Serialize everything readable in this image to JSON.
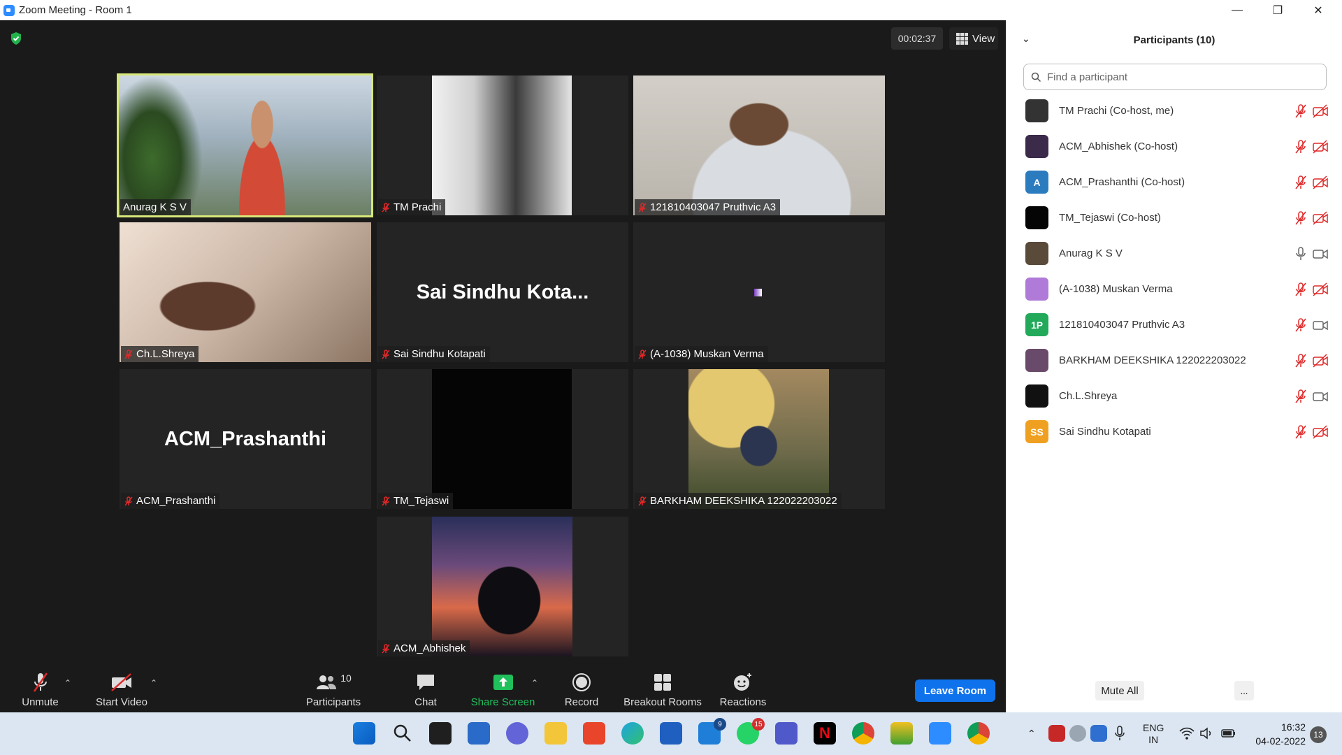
{
  "window": {
    "title": "Zoom Meeting - Room 1"
  },
  "meeting": {
    "timer": "00:02:37",
    "view_label": "View",
    "tiles": [
      {
        "name": "Anurag K S V",
        "muted": false,
        "active": true,
        "show_name_only": false
      },
      {
        "name": "TM Prachi",
        "muted": true,
        "show_name_only": false
      },
      {
        "name": "121810403047 Pruthvic A3",
        "muted": true,
        "show_name_only": false
      },
      {
        "name": "Ch.L.Shreya",
        "muted": true,
        "show_name_only": false
      },
      {
        "name": "Sai Sindhu Kotapati",
        "display": "Sai Sindhu Kota...",
        "muted": true,
        "show_name_only": true
      },
      {
        "name": "(A-1038) Muskan Verma",
        "muted": true,
        "show_name_only": false
      },
      {
        "name": "ACM_Prashanthi",
        "display": "ACM_Prashanthi",
        "muted": true,
        "show_name_only": true
      },
      {
        "name": "TM_Tejaswi",
        "muted": true,
        "show_name_only": false
      },
      {
        "name": "BARKHAM DEEKSHIKA 122022203022",
        "muted": true,
        "show_name_only": false
      },
      {
        "name": "ACM_Abhishek",
        "muted": true,
        "show_name_only": false
      }
    ]
  },
  "toolbar": {
    "unmute": "Unmute",
    "start_video": "Start Video",
    "participants": "Participants",
    "participants_count": "10",
    "chat": "Chat",
    "share_screen": "Share Screen",
    "record": "Record",
    "breakout_rooms": "Breakout Rooms",
    "reactions": "Reactions",
    "leave_room": "Leave Room"
  },
  "panel": {
    "title": "Participants (10)",
    "search_placeholder": "Find a participant",
    "participants": [
      {
        "name": "TM Prachi (Co-host, me)",
        "avatar_color": "#333333",
        "initials": "",
        "mic": "muted",
        "cam": "off"
      },
      {
        "name": "ACM_Abhishek (Co-host)",
        "avatar_color": "#3b2a4a",
        "initials": "",
        "mic": "muted",
        "cam": "off"
      },
      {
        "name": "ACM_Prashanthi (Co-host)",
        "avatar_color": "#2b7bbf",
        "initials": "A",
        "mic": "muted",
        "cam": "off"
      },
      {
        "name": "TM_Tejaswi (Co-host)",
        "avatar_color": "#050505",
        "initials": "",
        "mic": "muted",
        "cam": "off"
      },
      {
        "name": "Anurag K S V",
        "avatar_color": "#5a4a3a",
        "initials": "",
        "mic": "on",
        "cam": "on"
      },
      {
        "name": "(A-1038) Muskan Verma",
        "avatar_color": "#b07ad8",
        "initials": "",
        "mic": "muted",
        "cam": "off"
      },
      {
        "name": "121810403047 Pruthvic A3",
        "avatar_color": "#22a95a",
        "initials": "1P",
        "mic": "muted",
        "cam": "on"
      },
      {
        "name": "BARKHAM DEEKSHIKA 122022203022",
        "avatar_color": "#6a4a6a",
        "initials": "",
        "mic": "muted",
        "cam": "off"
      },
      {
        "name": "Ch.L.Shreya",
        "avatar_color": "#111111",
        "initials": "",
        "mic": "muted",
        "cam": "on"
      },
      {
        "name": "Sai Sindhu Kotapati",
        "avatar_color": "#f0a020",
        "initials": "SS",
        "mic": "muted",
        "cam": "off"
      }
    ],
    "mute_all": "Mute All",
    "more": "..."
  },
  "taskbar": {
    "lang_top": "ENG",
    "lang_bottom": "IN",
    "time": "16:32",
    "date": "04-02-2022",
    "notifications": "13",
    "mail_badge": "9",
    "whatsapp_badge": "15"
  },
  "colors": {
    "zoom_blue": "#0e72ed",
    "muted_red": "#e02828",
    "share_green": "#20c05c",
    "active_border": "#d7e77a"
  }
}
